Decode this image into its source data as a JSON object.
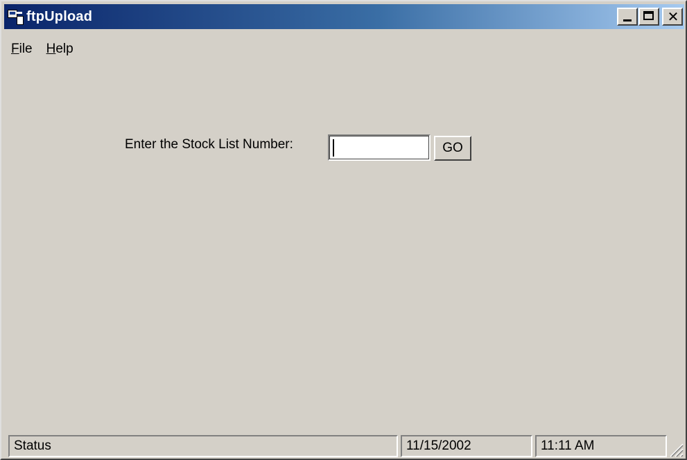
{
  "window": {
    "title": "ftpUpload",
    "icon": "ftp-app-icon",
    "controls": {
      "minimize": "minimize-icon",
      "maximize": "maximize-icon",
      "close": "close-icon"
    }
  },
  "menu": {
    "items": [
      {
        "accel": "F",
        "rest": "ile"
      },
      {
        "accel": "H",
        "rest": "elp"
      }
    ]
  },
  "form": {
    "prompt_label": "Enter the Stock List Number:",
    "stock_input_value": "",
    "go_label": "GO"
  },
  "statusbar": {
    "status_text": "Status",
    "date_text": "11/15/2002",
    "time_text": "11:11 AM"
  },
  "colors": {
    "titlebar_start": "#0a246a",
    "titlebar_end": "#a6caf0",
    "face": "#d4d0c8"
  }
}
